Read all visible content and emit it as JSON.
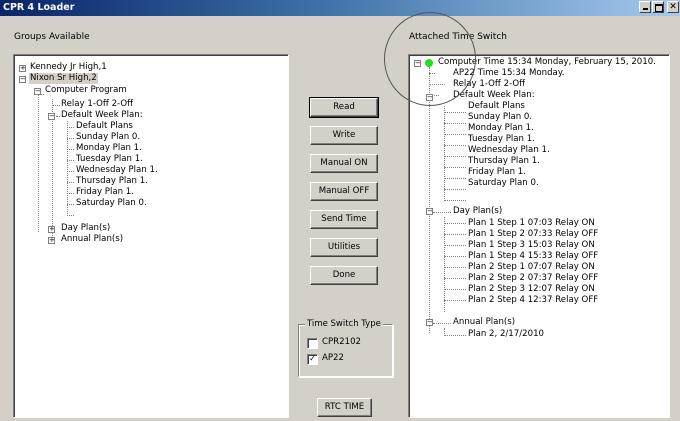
{
  "window": {
    "title": "CPR 4 Loader"
  },
  "left": {
    "heading": "Groups Available",
    "tree": [
      "Kennedy Jr High,1",
      "Nixon Sr High,2",
      "Computer Program",
      "Relay 1-Off 2-Off",
      "Default Week Plan:",
      "Default Plans",
      "Sunday Plan 0.",
      "Monday Plan 1.",
      "Tuesday Plan 1.",
      "Wednesday Plan 1.",
      "Thursday Plan 1.",
      "Friday Plan 1.",
      "Saturday Plan 0.",
      "Day Plan(s)",
      "Annual Plan(s)"
    ]
  },
  "buttons": {
    "read": "Read",
    "write": "Write",
    "manual_on": "Manual ON",
    "manual_off": "Manual OFF",
    "send_time": "Send Time",
    "utilities": "Utilities",
    "done": "Done",
    "rtc_time": "RTC TIME"
  },
  "switch_type": {
    "legend": "Time Switch Type",
    "options": [
      {
        "label": "CPR2102",
        "checked": false
      },
      {
        "label": "AP22",
        "checked": true
      }
    ]
  },
  "right": {
    "heading": "Attached Time Switch",
    "tree": [
      "Computer Time 15:34 Monday, February 15, 2010.",
      "AP22 Time 15:34 Monday.",
      "Relay 1-Off 2-Off",
      "Default Week Plan:",
      "Default Plans",
      "Sunday Plan 0.",
      "Monday Plan 1.",
      "Tuesday Plan 1.",
      "Wednesday Plan 1.",
      "Thursday Plan 1.",
      "Friday Plan 1.",
      "Saturday Plan 0.",
      "Day Plan(s)",
      "Plan 1 Step 1 07:03 Relay ON",
      "Plan 1 Step 2 07:33 Relay OFF",
      "Plan 1 Step 3 15:03 Relay ON",
      "Plan 1 Step 4 15:33 Relay OFF",
      "Plan 2 Step 1 07:07 Relay ON",
      "Plan 2 Step 2 07:37 Relay OFF",
      "Plan 2 Step 3 12:07 Relay ON",
      "Plan 2 Step 4 12:37 Relay OFF",
      "Annual Plan(s)",
      "Plan 2, 2/17/2010"
    ]
  },
  "status_colors": {
    "connected": "#22dd22"
  }
}
